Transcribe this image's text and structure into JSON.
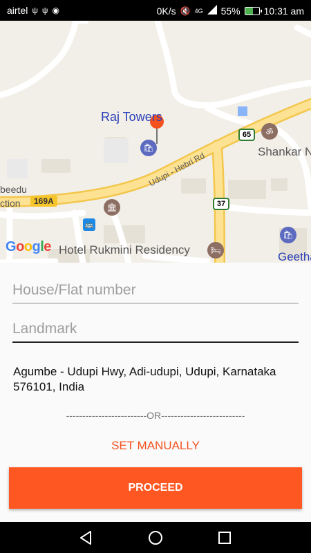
{
  "status_bar": {
    "carrier": "airtel",
    "network_speed": "0K/s",
    "network_type": "4G",
    "battery_percent": "55%",
    "battery_level": 0.55,
    "time": "10:31 am",
    "icons": [
      "usb-icon",
      "usb-icon",
      "message-icon",
      "mute-icon",
      "signal-icon",
      "battery-icon"
    ]
  },
  "map": {
    "labels": {
      "raj_towers": "Raj Towers",
      "udupi_hebri_rd": "Udupi - Hebri Rd",
      "shankar": "Shankar N",
      "beedu": "beedu",
      "ction": "ction",
      "hotel": "Hotel Rukmini Residency",
      "geetha": "Geetha"
    },
    "shields": {
      "route_65": "65",
      "route_37": "37",
      "route_169a": "169A"
    },
    "google": [
      "G",
      "o",
      "o",
      "g",
      "l",
      "e"
    ],
    "colors": {
      "land": "#f2efe8",
      "road_major": "#fdd96b",
      "road_minor": "#ffffff",
      "pin": "#f4511e",
      "poi_blue": "#5c6bc0",
      "poi_brown": "#8d6e63"
    }
  },
  "form": {
    "house_placeholder": "House/Flat number",
    "house_value": "",
    "landmark_placeholder": "Landmark",
    "landmark_value": "",
    "address": "Agumbe - Udupi Hwy, Adi-udupi, Udupi, Karnataka 576101, India",
    "or_divider": "-------------------------OR--------------------------",
    "set_manually": "SET MANUALLY",
    "proceed": "PROCEED"
  },
  "colors": {
    "accent": "#ff5722",
    "link": "#f4511e",
    "status_bar_bg": "#000000"
  },
  "nav_bar": {
    "buttons": [
      "back-icon",
      "home-icon",
      "recents-icon"
    ]
  }
}
